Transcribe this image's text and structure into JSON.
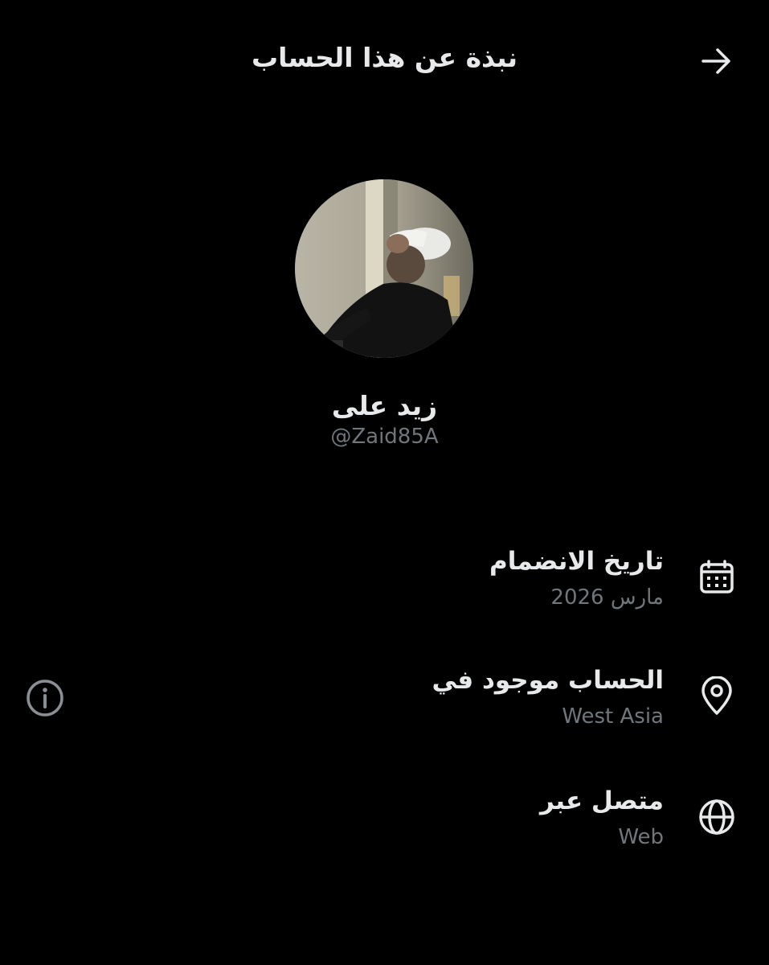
{
  "header": {
    "title": "نبذة عن هذا الحساب",
    "back_icon": "arrow-right-icon"
  },
  "profile": {
    "display_name": "زيد على",
    "handle": "@Zaid85A"
  },
  "details": [
    {
      "icon": "calendar-icon",
      "label": "تاريخ الانضمام",
      "value": "مارس 2026"
    },
    {
      "icon": "location-pin-icon",
      "label": "الحساب موجود في",
      "value": "West Asia"
    },
    {
      "icon": "globe-icon",
      "label": "متصل عبر",
      "value": "Web"
    }
  ],
  "info_icon": "info-icon",
  "colors": {
    "background": "#000000",
    "primary_text": "#e7e9ea",
    "secondary_text": "#71767b"
  }
}
